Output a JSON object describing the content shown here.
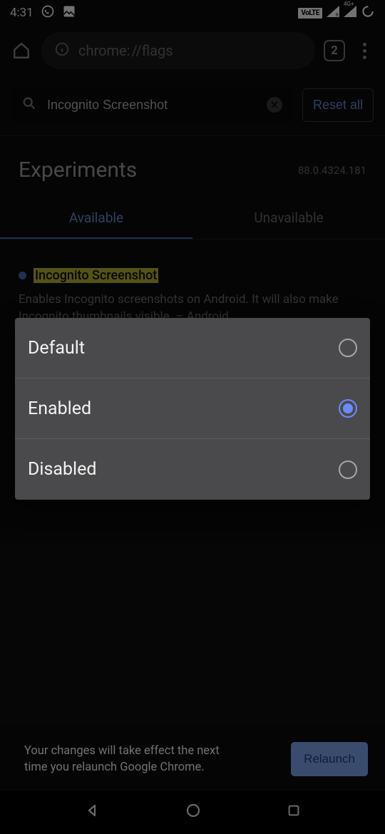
{
  "status_bar": {
    "time": "4:31",
    "volte": "VoLTE",
    "net": "4G+"
  },
  "toolbar": {
    "url_scheme": "chrome:",
    "url_path": "//flags",
    "tab_count": "2"
  },
  "search": {
    "value": "Incognito Screenshot",
    "reset_label": "Reset all"
  },
  "header": {
    "title": "Experiments",
    "version": "88.0.4324.181"
  },
  "tabs": {
    "available": "Available",
    "unavailable": "Unavailable"
  },
  "flag": {
    "name": "Incognito Screenshot",
    "description": "Enables Incognito screenshots on Android. It will also make Incognito thumbnails visible. – Android"
  },
  "dropdown": {
    "options": [
      {
        "label": "Default",
        "selected": false
      },
      {
        "label": "Enabled",
        "selected": true
      },
      {
        "label": "Disabled",
        "selected": false
      }
    ]
  },
  "relaunch": {
    "text": "Your changes will take effect the next time you relaunch Google Chrome.",
    "button": "Relaunch"
  }
}
